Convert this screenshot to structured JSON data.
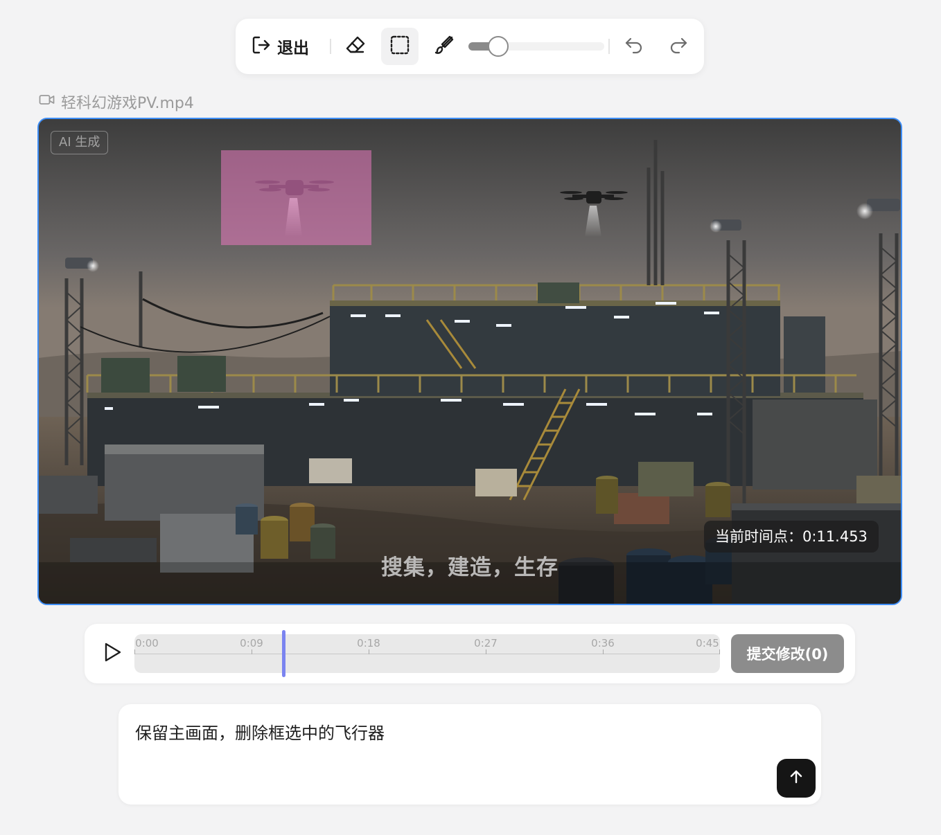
{
  "toolbar": {
    "exit_label": "退出",
    "brush_size_fraction": 0.22
  },
  "file": {
    "name": "轻科幻游戏PV.mp4"
  },
  "video": {
    "ai_badge": "AI 生成",
    "current_time_label": "当前时间点：0:11.453",
    "subtitle": "搜集，建造，生存"
  },
  "timeline": {
    "ticks": [
      "0:00",
      "0:09",
      "0:18",
      "0:27",
      "0:36",
      "0:45"
    ],
    "duration_seconds": 45,
    "current_seconds": 11.453,
    "submit_label": "提交修改(0)"
  },
  "prompt": {
    "text": "保留主画面，删除框选中的飞行器"
  },
  "colors": {
    "accent_blue": "#3e8ef7",
    "playhead": "#7b84f0",
    "selection": "#e878be",
    "send_button": "#151515"
  }
}
